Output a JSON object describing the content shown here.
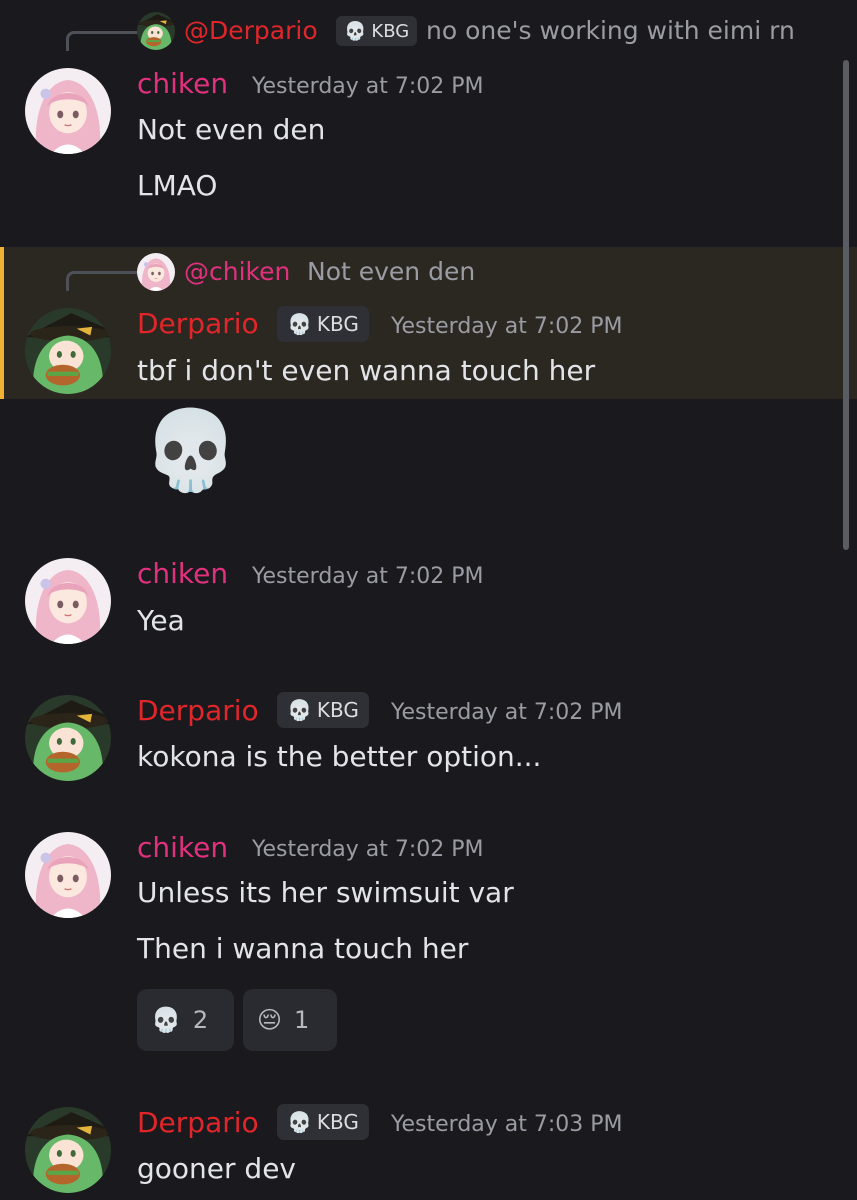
{
  "colors": {
    "background": "#1a1a1e",
    "chiken_name": "#e0317e",
    "derpario_name": "#e0262a",
    "highlight_bg": "#2b2822",
    "highlight_bar": "#f0b232"
  },
  "feed": {
    "reply1": {
      "mention": "@Derpario",
      "tag_icon": "skull-icon",
      "tag": "KBG",
      "text": "no one's working with eimi rn"
    },
    "msg1": {
      "author": "chiken",
      "time": "Yesterday at 7:02 PM",
      "lines": [
        "Not even den",
        "LMAO"
      ]
    },
    "reply2": {
      "mention": "@chiken",
      "text": "Not even den"
    },
    "msg2": {
      "author": "Derpario",
      "tag": "KBG",
      "time": "Yesterday at 7:02 PM",
      "line": "tbf i don't even wanna touch her",
      "emoji": "💀"
    },
    "msg3": {
      "author": "chiken",
      "time": "Yesterday at 7:02 PM",
      "line": "Yea"
    },
    "msg4": {
      "author": "Derpario",
      "tag": "KBG",
      "time": "Yesterday at 7:02 PM",
      "line": "kokona is the better option..."
    },
    "msg5": {
      "author": "chiken",
      "time": "Yesterday at 7:02 PM",
      "lines": [
        "Unless its her swimsuit var",
        "Then i wanna touch her"
      ],
      "reactions": [
        {
          "emoji": "💀",
          "count": "2"
        },
        {
          "emoji": "😔",
          "count": "1"
        }
      ]
    },
    "msg6": {
      "author": "Derpario",
      "tag": "KBG",
      "time": "Yesterday at 7:03 PM",
      "line": "gooner dev"
    }
  }
}
